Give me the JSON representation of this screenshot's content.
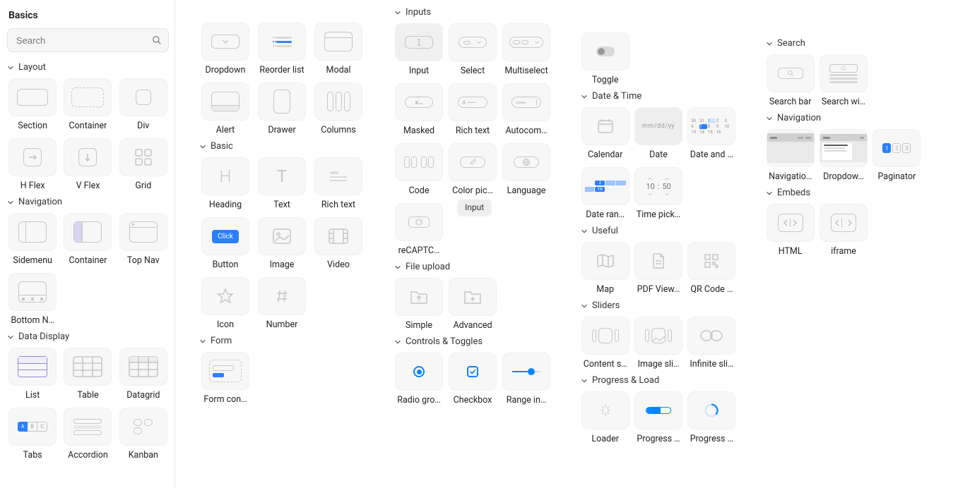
{
  "panel": {
    "title": "Basics"
  },
  "search": {
    "placeholder": "Search"
  },
  "tooltip": "Input",
  "col1": [
    {
      "title": "Layout",
      "items": [
        "Section",
        "Container",
        "Div",
        "H Flex",
        "V Flex",
        "Grid"
      ]
    },
    {
      "title": "Navigation",
      "items": [
        "Sidemenu",
        "Container",
        "Top Nav",
        "Bottom N…"
      ]
    },
    {
      "title": "Data Display",
      "items": [
        "List",
        "Table",
        "Datagrid",
        "Tabs",
        "Accordion",
        "Kanban"
      ]
    }
  ],
  "col2": [
    {
      "title": null,
      "items": [
        "Dropdown",
        "Reorder list",
        "Modal",
        "Alert",
        "Drawer",
        "Columns"
      ]
    },
    {
      "title": "Basic",
      "items": [
        "Heading",
        "Text",
        "Rich text",
        "Button",
        "Image",
        "Video",
        "Icon",
        "Number"
      ]
    },
    {
      "title": "Form",
      "items": [
        "Form con…"
      ]
    }
  ],
  "col3": [
    {
      "title": "Inputs",
      "items": [
        "Input",
        "Select",
        "Multiselect",
        "Masked",
        "Rich text",
        "Autocom…",
        "Code",
        "Color pic…",
        "Language",
        "reCAPTC…"
      ]
    },
    {
      "title": "File upload",
      "items": [
        "Simple",
        "Advanced"
      ]
    },
    {
      "title": "Controls & Toggles",
      "items": [
        "Radio gro…",
        "Checkbox",
        "Range in…"
      ]
    }
  ],
  "col4": [
    {
      "title": null,
      "items": [
        "Toggle"
      ]
    },
    {
      "title": "Date & Time",
      "items": [
        "Calendar",
        "Date",
        "Date and …",
        "Date ran…",
        "Time pick…"
      ]
    },
    {
      "title": "Useful",
      "items": [
        "Map",
        "PDF View…",
        "QR Code …"
      ]
    },
    {
      "title": "Sliders",
      "items": [
        "Content s…",
        "Image sli…",
        "Infinite sli…"
      ]
    },
    {
      "title": "Progress & Load",
      "items": [
        "Loader",
        "Progress …",
        "Progress …"
      ]
    }
  ],
  "col5": [
    {
      "title": "Search",
      "items": [
        "Search bar",
        "Search wi…"
      ]
    },
    {
      "title": "Navigation",
      "items": [
        "Navigatio…",
        "Dropdow…",
        "Paginator"
      ]
    },
    {
      "title": "Embeds",
      "items": [
        "HTML",
        "iframe"
      ]
    }
  ],
  "date_placeholder": "mm/dd/yy",
  "time_values": {
    "h": "10",
    "m": "50"
  },
  "btn_label": "Click"
}
